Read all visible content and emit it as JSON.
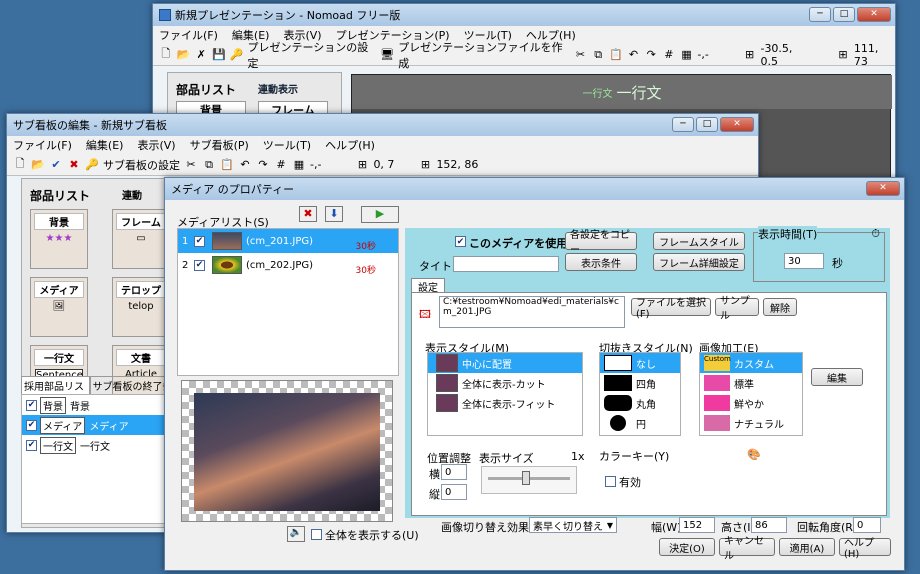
{
  "main_window": {
    "title": "新規プレゼンテーション - Nomoad フリー版",
    "menu": [
      "ファイル(F)",
      "編集(E)",
      "表示(V)",
      "プレゼンテーション(P)",
      "ツール(T)",
      "ヘルプ(H)"
    ],
    "toolbar": {
      "settings": "プレゼンテーションの設定",
      "create": "プレゼンテーションファイルを作成",
      "coords": "-30.5, 0.5",
      "size": "111, 73",
      "cursor": "-,-"
    },
    "parts_title": "部品リスト",
    "link": "連動表示",
    "part_bg": "背景",
    "part_frame": "フレーム",
    "preview_small": "一行文",
    "preview_big": "一行文"
  },
  "sub_window": {
    "title": "サブ看板の編集 - 新規サブ看板",
    "menu": [
      "ファイル(F)",
      "編集(E)",
      "表示(V)",
      "サブ看板(P)",
      "ツール(T)",
      "ヘルプ(H)"
    ],
    "toolbar": {
      "settings": "サブ看板の設定",
      "cursor": "-,-",
      "coords": "0, 7",
      "size": "152, 86"
    },
    "parts_title": "部品リスト",
    "link": "連動",
    "parts": [
      {
        "label": "背景"
      },
      {
        "label": "フレーム"
      },
      {
        "label": "メディア"
      },
      {
        "label": "テロップ",
        "inner": "telop"
      },
      {
        "label": "一行文",
        "inner": "Sentence"
      },
      {
        "label": "文書",
        "inner": "Article"
      }
    ],
    "tabs": [
      "採用部品リスト",
      "サブ看板の終了条件"
    ],
    "used": [
      {
        "tag": "背景",
        "name": "背景"
      },
      {
        "tag": "メディア",
        "name": "メディア"
      },
      {
        "tag": "一行文",
        "name": "一行文"
      }
    ]
  },
  "media_dialog": {
    "title": "メディア のプロパティー",
    "list_label": "メディアリスト(S)",
    "items": [
      {
        "num": "1",
        "name": "(cm_201.JPG)",
        "sec": "30秒"
      },
      {
        "num": "2",
        "name": "(cm_202.JPG)",
        "sec": "30秒"
      }
    ],
    "use_media": "このメディアを使用する",
    "copy": "各設定をコピー",
    "display_cond": "表示条件",
    "frame_style": "フレームスタイル",
    "frame_detail": "フレーム詳細設定",
    "duration_label": "表示時間(T)",
    "duration": "30",
    "sec_unit": "秒",
    "title_label": "タイトル",
    "settings_tab": "設定",
    "path": "C:¥testroom¥Nomoad¥edi_materials¥cm_201.JPG",
    "select_file": "ファイルを選択(F)",
    "sample": "サンプル",
    "clear": "解除",
    "display_style": "表示スタイル(M)",
    "styles": [
      "中心に配置",
      "全体に表示-カット",
      "全体に表示-フィット"
    ],
    "crop_style": "切抜きスタイル(N)",
    "crops": [
      "なし",
      "四角",
      "丸角",
      "円"
    ],
    "image_proc": "画像加工(E)",
    "procs": [
      "カスタム",
      "標準",
      "鮮やか",
      "ナチュラル"
    ],
    "custom_word": "Custom",
    "edit": "編集",
    "pos_adjust": "位置調整",
    "h_label": "横",
    "v_label": "縦",
    "h_val": "0",
    "v_val": "0",
    "size_label": "表示サイズ",
    "size_val": "1x",
    "color_key": "カラーキー(Y)",
    "enable": "有効",
    "show_all": "全体を表示する(U)",
    "switch_label": "画像切り替え効果(C)",
    "switch_val": "素早く切り替え",
    "width_label": "幅(W)",
    "width": "152",
    "height_label": "高さ(I)",
    "height": "86",
    "rot_label": "回転角度(R)",
    "rot": "0",
    "ok": "決定(O)",
    "cancel": "キャンセル",
    "apply": "適用(A)",
    "help": "ヘルプ(H)"
  }
}
